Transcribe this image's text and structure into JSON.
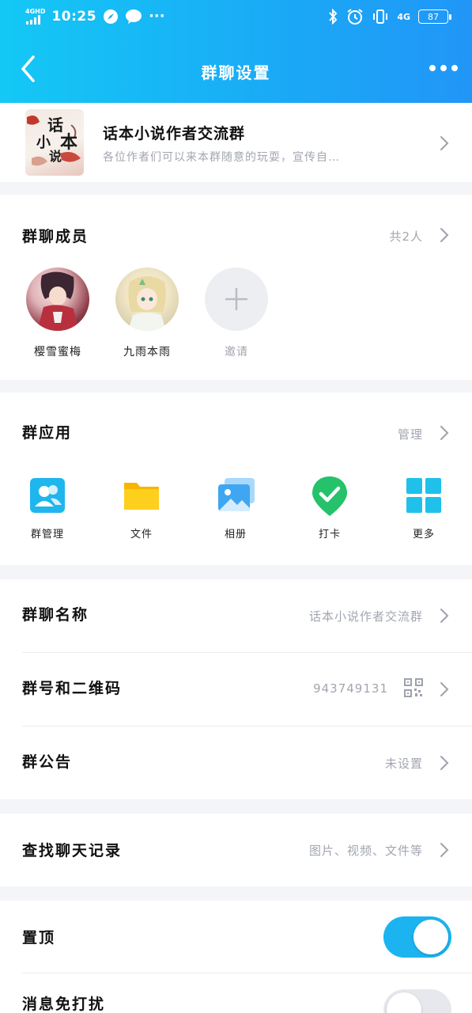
{
  "status_bar": {
    "network": "4GHD",
    "time": "10:25",
    "more": "···",
    "right_network": "4G",
    "battery": "87"
  },
  "nav": {
    "title": "群聊设置"
  },
  "group": {
    "avatar_text_1": "话",
    "avatar_text_2": "小",
    "avatar_text_3": "本",
    "avatar_text_4": "说",
    "name": "话本小说作者交流群",
    "description": "各位作者们可以来本群随意的玩耍，宣传自…"
  },
  "members": {
    "title": "群聊成员",
    "count": "共2人",
    "list": [
      {
        "name": "樱雪蜜梅"
      },
      {
        "name": "九雨本雨"
      }
    ],
    "invite_label": "邀请"
  },
  "apps": {
    "title": "群应用",
    "manage": "管理",
    "items": [
      {
        "label": "群管理",
        "icon": "group-manage-icon"
      },
      {
        "label": "文件",
        "icon": "folder-icon"
      },
      {
        "label": "相册",
        "icon": "album-icon"
      },
      {
        "label": "打卡",
        "icon": "checkin-icon"
      },
      {
        "label": "更多",
        "icon": "grid-icon"
      }
    ]
  },
  "settings": {
    "name_label": "群聊名称",
    "name_value": "话本小说作者交流群",
    "id_label": "群号和二维码",
    "id_value": "943749131",
    "notice_label": "群公告",
    "notice_value": "未设置"
  },
  "search": {
    "label": "查找聊天记录",
    "hint": "图片、视频、文件等"
  },
  "toggles": {
    "pin_label": "置顶",
    "pin_on": true,
    "mute_label": "消息免打扰",
    "mute_on": false
  },
  "colors": {
    "accent": "#1bb4f0",
    "header_start": "#14c8f5",
    "header_end": "#2196f7"
  }
}
